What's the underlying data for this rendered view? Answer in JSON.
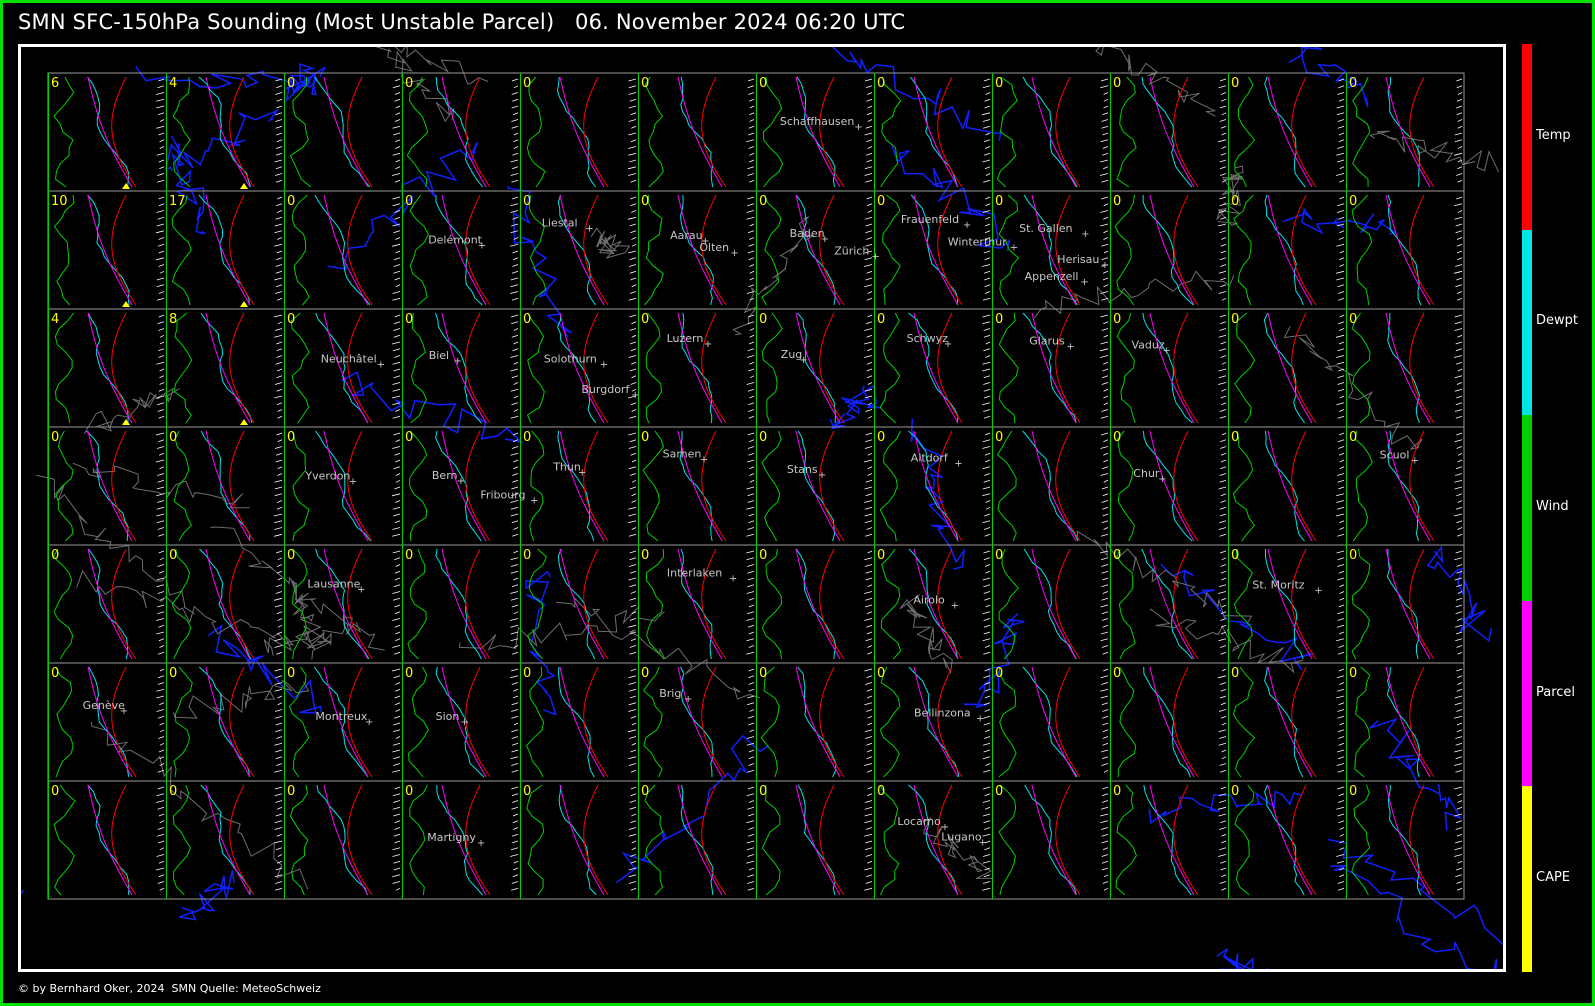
{
  "header": {
    "title": "SMN SFC-150hPa Sounding (Most Unstable Parcel)",
    "datetime": "06. November 2024 06:20 UTC"
  },
  "footer": {
    "credit": "© by Bernhard Oker, 2024  SMN Quelle: MeteoSchweiz"
  },
  "legend": [
    {
      "label": "Temp",
      "color": "#ff0000"
    },
    {
      "label": "Dewpt",
      "color": "#00e5e5"
    },
    {
      "label": "Wind",
      "color": "#00d000"
    },
    {
      "label": "Parcel",
      "color": "#ff00ff"
    },
    {
      "label": "CAPE",
      "color": "#ffff00"
    }
  ],
  "colors": {
    "frame": "#00e000",
    "grid": "#9a9a9a",
    "cape_text": "#ffff00",
    "lakes_rivers": "#1020ff",
    "borders": "#6e6e6e",
    "city_text": "#c8c8c8"
  },
  "chart_data": {
    "type": "table",
    "rows": 7,
    "cols": 12,
    "cape_values": [
      [
        6,
        4,
        0,
        0,
        0,
        0,
        0,
        0,
        0,
        0,
        0,
        0
      ],
      [
        10,
        17,
        0,
        0,
        0,
        0,
        0,
        0,
        0,
        0,
        0,
        0
      ],
      [
        4,
        8,
        0,
        0,
        0,
        0,
        0,
        0,
        0,
        0,
        0,
        0
      ],
      [
        0,
        0,
        0,
        0,
        0,
        0,
        0,
        0,
        0,
        0,
        0,
        0
      ],
      [
        0,
        0,
        0,
        0,
        0,
        0,
        0,
        0,
        0,
        0,
        0,
        0
      ],
      [
        0,
        0,
        0,
        0,
        0,
        0,
        0,
        0,
        0,
        0,
        0,
        0
      ],
      [
        0,
        0,
        0,
        0,
        0,
        0,
        0,
        0,
        0,
        0,
        0,
        0
      ]
    ],
    "cities": [
      {
        "name": "Schaffhausen",
        "row": 0,
        "col": 6
      },
      {
        "name": "Frauenfeld",
        "row": 1,
        "col": 7
      },
      {
        "name": "Liestal",
        "row": 1,
        "col": 4
      },
      {
        "name": "Winterthur",
        "row": 1,
        "col": 7
      },
      {
        "name": "St. Gallen",
        "row": 1,
        "col": 8
      },
      {
        "name": "Baden",
        "row": 1,
        "col": 6
      },
      {
        "name": "Aarau",
        "row": 1,
        "col": 5
      },
      {
        "name": "Delémont",
        "row": 1,
        "col": 3
      },
      {
        "name": "Zürich",
        "row": 1,
        "col": 6
      },
      {
        "name": "Herisau",
        "row": 1,
        "col": 8
      },
      {
        "name": "Olten",
        "row": 1,
        "col": 5
      },
      {
        "name": "Appenzell",
        "row": 1,
        "col": 8
      },
      {
        "name": "Solothurn",
        "row": 2,
        "col": 4
      },
      {
        "name": "Zug",
        "row": 2,
        "col": 6
      },
      {
        "name": "Biel",
        "row": 2,
        "col": 3
      },
      {
        "name": "Vaduz",
        "row": 2,
        "col": 9
      },
      {
        "name": "Burgdorf",
        "row": 2,
        "col": 4
      },
      {
        "name": "Glarus",
        "row": 2,
        "col": 8
      },
      {
        "name": "Luzern",
        "row": 2,
        "col": 5
      },
      {
        "name": "Neuchâtel",
        "row": 2,
        "col": 2
      },
      {
        "name": "Schwyz",
        "row": 2,
        "col": 7
      },
      {
        "name": "Bern",
        "row": 3,
        "col": 3
      },
      {
        "name": "Stans",
        "row": 3,
        "col": 6
      },
      {
        "name": "Sarnen",
        "row": 3,
        "col": 5
      },
      {
        "name": "Altdorf",
        "row": 3,
        "col": 7
      },
      {
        "name": "Chur",
        "row": 3,
        "col": 9
      },
      {
        "name": "Scuol",
        "row": 3,
        "col": 11
      },
      {
        "name": "Fribourg",
        "row": 3,
        "col": 3
      },
      {
        "name": "Yverdon",
        "row": 3,
        "col": 2
      },
      {
        "name": "Thun",
        "row": 3,
        "col": 4
      },
      {
        "name": "Interlaken",
        "row": 4,
        "col": 5
      },
      {
        "name": "Airolo",
        "row": 4,
        "col": 7
      },
      {
        "name": "Lausanne",
        "row": 4,
        "col": 2
      },
      {
        "name": "St. Moritz",
        "row": 4,
        "col": 10
      },
      {
        "name": "Montreux",
        "row": 5,
        "col": 2
      },
      {
        "name": "Brig",
        "row": 5,
        "col": 5
      },
      {
        "name": "Genève",
        "row": 5,
        "col": 0
      },
      {
        "name": "Sion",
        "row": 5,
        "col": 3
      },
      {
        "name": "Bellinzona",
        "row": 5,
        "col": 7
      },
      {
        "name": "Locarno",
        "row": 6,
        "col": 7
      },
      {
        "name": "Martigny",
        "row": 6,
        "col": 3
      },
      {
        "name": "Lugano",
        "row": 6,
        "col": 7
      }
    ]
  }
}
